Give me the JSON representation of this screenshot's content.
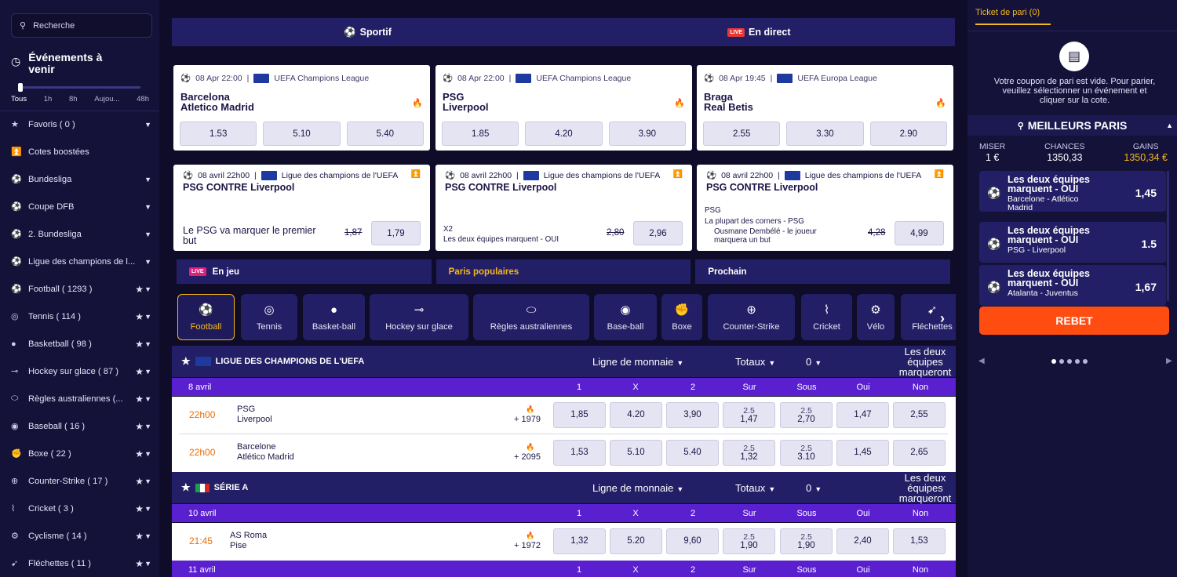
{
  "search": {
    "placeholder": "Recherche"
  },
  "events": {
    "title_line1": "Événements à",
    "title_line2": "venir",
    "time_filters": [
      "Tous",
      "1h",
      "8h",
      "Aujou...",
      "48h"
    ]
  },
  "sidebar": {
    "items": [
      {
        "label": "Favoris ( 0 )",
        "icon": "star-icon",
        "suffix": "caret"
      },
      {
        "label": "Cotes boostées",
        "icon": "boost-icon",
        "suffix": ""
      },
      {
        "label": "Bundesliga",
        "icon": "football-icon",
        "suffix": "caret"
      },
      {
        "label": "Coupe DFB",
        "icon": "football-icon",
        "suffix": "caret"
      },
      {
        "label": "2. Bundesliga",
        "icon": "football-icon",
        "suffix": "caret"
      },
      {
        "label": "Ligue des champions de l...",
        "icon": "football-icon",
        "suffix": "caret"
      },
      {
        "label": "Football ( 1293 )",
        "icon": "football-icon",
        "suffix": "star-caret"
      },
      {
        "label": "Tennis ( 114 )",
        "icon": "tennis-icon",
        "suffix": "star-caret"
      },
      {
        "label": "Basketball ( 98 )",
        "icon": "basketball-icon",
        "suffix": "star-caret"
      },
      {
        "label": "Hockey sur glace ( 87 )",
        "icon": "hockey-icon",
        "suffix": "star-caret"
      },
      {
        "label": "Règles australiennes (...",
        "icon": "rugby-icon",
        "suffix": "star-caret"
      },
      {
        "label": "Baseball ( 16 )",
        "icon": "baseball-icon",
        "suffix": "star-caret"
      },
      {
        "label": "Boxe ( 22 )",
        "icon": "boxing-icon",
        "suffix": "star-caret"
      },
      {
        "label": "Counter-Strike ( 17 )",
        "icon": "counter-strike-icon",
        "suffix": "star-caret"
      },
      {
        "label": "Cricket ( 3 )",
        "icon": "cricket-icon",
        "suffix": "star-caret"
      },
      {
        "label": "Cyclisme ( 14 )",
        "icon": "cycling-icon",
        "suffix": "star-caret"
      },
      {
        "label": "Fléchettes ( 11 )",
        "icon": "darts-icon",
        "suffix": "star-caret"
      }
    ]
  },
  "topnav": {
    "sport": "Sportif",
    "live": "En direct",
    "live_badge": "LIVE"
  },
  "featured": [
    {
      "date": "08 Apr 22:00",
      "league": "UEFA Champions League",
      "team1": "Barcelona",
      "team2": "Atletico Madrid",
      "odds": [
        "1.53",
        "5.10",
        "5.40"
      ]
    },
    {
      "date": "08 Apr 22:00",
      "league": "UEFA Champions League",
      "team1": "PSG",
      "team2": "Liverpool",
      "odds": [
        "1.85",
        "4.20",
        "3.90"
      ]
    },
    {
      "date": "08 Apr 19:45",
      "league": "UEFA Europa League",
      "team1": "Braga",
      "team2": "Real Betis",
      "odds": [
        "2.55",
        "3.30",
        "2.90"
      ]
    }
  ],
  "betbuilder": [
    {
      "date": "08 avril 22h00",
      "league": "Ligue des champions de l'UEFA",
      "title": "PSG CONTRE Liverpool",
      "desc_line1": "Le PSG va marquer le premier",
      "desc_line2": "but",
      "old": "1,87",
      "odd": "1,79"
    },
    {
      "date": "08 avril 22h00",
      "league": "Ligue des champions de l'UEFA",
      "title": "PSG CONTRE Liverpool",
      "sel1": "X2",
      "sel2": "Les deux équipes marquent - OUI",
      "old": "2,80",
      "odd": "2,96"
    },
    {
      "date": "08 avril 22h00",
      "league": "Ligue des champions de l'UEFA",
      "title": "PSG CONTRE Liverpool",
      "sel1": "PSG",
      "sel2": "La plupart des corners - PSG",
      "sel3": "Ousmane Dembélé - le joueur",
      "sel4": "marquera un but",
      "old": "4,28",
      "odd": "4,99"
    }
  ],
  "filter_tabs": [
    "En jeu",
    "Paris populaires",
    "Prochain"
  ],
  "sport_tabs": [
    "Football",
    "Tennis",
    "Basket-ball",
    "Hockey sur glace",
    "Règles australiennes",
    "Base-ball",
    "Boxe",
    "Counter-Strike",
    "Cricket",
    "Vélo",
    "Fléchettes"
  ],
  "table": {
    "market_moneyline": "Ligne de monnaie",
    "market_totals": "Totaux",
    "market_zero": "0",
    "market_both_l1": "Les deux",
    "market_both_l2": "équipes",
    "market_both_l3": "marqueront",
    "col_headers": [
      "1",
      "X",
      "2",
      "Sur",
      "Sous",
      "Oui",
      "Non"
    ],
    "leagues": [
      {
        "name": "LIGUE DES CHAMPIONS DE L'UEFA",
        "date": "8 avril",
        "matches": [
          {
            "time": "22h00",
            "team1": "PSG",
            "team2": "Liverpool",
            "count": "+ 1979",
            "o1": "1,85",
            "ox": "4.20",
            "o2": "3,90",
            "over_line": "2.5",
            "over": "1,47",
            "under_line": "2.5",
            "under": "2,70",
            "yes": "1,47",
            "no": "2,55"
          },
          {
            "time": "22h00",
            "team1": "Barcelone",
            "team2": "Atlético Madrid",
            "count": "+ 2095",
            "o1": "1,53",
            "ox": "5.10",
            "o2": "5.40",
            "over_line": "2.5",
            "over": "1,32",
            "under_line": "2.5",
            "under": "3.10",
            "yes": "1,45",
            "no": "2,65"
          }
        ]
      },
      {
        "name": "SÉRIE A",
        "date": "10 avril",
        "matches": [
          {
            "time": "21:45",
            "team1": "AS Roma",
            "team2": "Pise",
            "count": "+ 1972",
            "o1": "1,32",
            "ox": "5.20",
            "o2": "9,60",
            "over_line": "2.5",
            "over": "1,90",
            "under_line": "2.5",
            "under": "1,90",
            "yes": "2,40",
            "no": "1,53"
          }
        ]
      },
      {
        "name": "",
        "date": "11 avril",
        "matches": []
      }
    ]
  },
  "ticket": {
    "tab": "Ticket de pari (0)",
    "empty_l1": "Votre coupon de pari est vide. Pour parier,",
    "empty_l2": "veuillez sélectionner un événement et",
    "empty_l3": "cliquer sur la cote.",
    "best_title": "MEILLEURS PARIS",
    "stake_label": "MISER",
    "stake": "1 €",
    "chances_label": "CHANCES",
    "chances": "1350,33",
    "gains_label": "GAINS",
    "gains": "1350,34 €",
    "bets": [
      {
        "t1": "Les deux équipes",
        "t2": "marquent - OUI",
        "s1": "Barcelone - Atlético",
        "s2": "Madrid",
        "odd": "1,45"
      },
      {
        "t1": "Les deux équipes",
        "t2": "marquent - OUI",
        "s1": "PSG - Liverpool",
        "s2": "",
        "odd": "1.5"
      },
      {
        "t1": "Les deux équipes",
        "t2": "marquent - OUI",
        "s1": "Atalanta - Juventus",
        "s2": "",
        "odd": "1,67"
      }
    ],
    "rebet": "REBET"
  },
  "colors": {
    "accent": "#f4b71c",
    "rebet": "#ff4d12",
    "date_row": "#5a20d0",
    "panel": "#231f66",
    "background": "#0f0c29"
  }
}
